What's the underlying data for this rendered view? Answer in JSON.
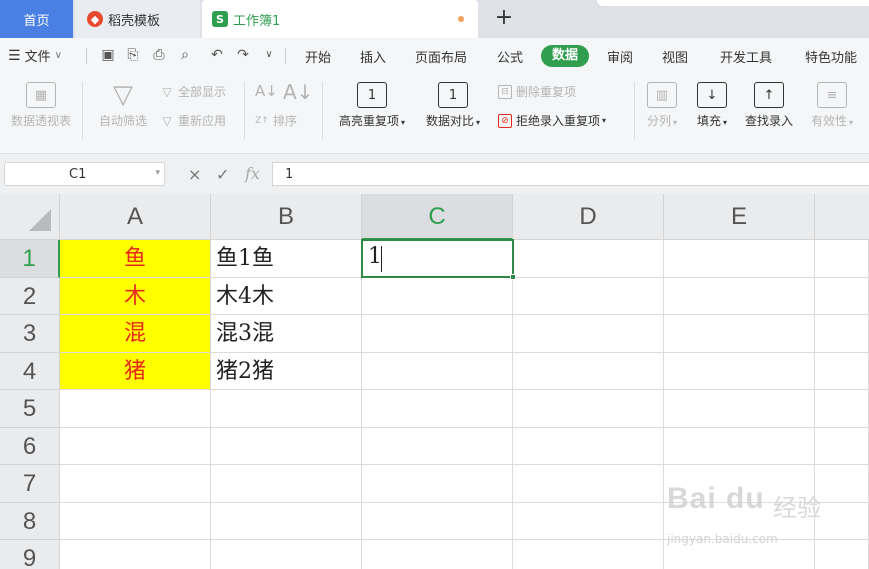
{
  "tabs": {
    "home": "首页",
    "docer": "稻壳模板",
    "workbook": "工作簿1",
    "add": "+"
  },
  "menu": {
    "file": "文件",
    "items": [
      "开始",
      "插入",
      "页面布局",
      "公式",
      "数据",
      "审阅",
      "视图",
      "开发工具",
      "特色功能"
    ],
    "active": "数据"
  },
  "ribbon": {
    "pivot": "数据透视表",
    "autofilter": "自动筛选",
    "show_all": "全部显示",
    "reapply": "重新应用",
    "sort": "排序",
    "highlight_dup": "高亮重复项",
    "compare": "数据对比",
    "remove_dup": "删除重复项",
    "reject_dup": "拒绝录入重复项",
    "split": "分列",
    "fill": "填充",
    "lookup": "查找录入",
    "validity": "有效性"
  },
  "formula_bar": {
    "name_box": "C1",
    "cancel": "×",
    "confirm": "✓",
    "fx": "fx",
    "value": "1"
  },
  "grid": {
    "columns": [
      "A",
      "B",
      "C",
      "D",
      "E"
    ],
    "selected_column": "C",
    "rows": [
      "1",
      "2",
      "3",
      "4",
      "5",
      "6",
      "7",
      "8",
      "9"
    ],
    "selected_row": "1",
    "col_a": [
      "鱼",
      "木",
      "混",
      "猪"
    ],
    "col_b": [
      "鱼1鱼",
      "木4木",
      "混3混",
      "猪2猪"
    ],
    "c1": "1",
    "highlight_color": "#ffff00",
    "text_color_a": "#e8281a",
    "accent": "#2f9f4f"
  },
  "watermark": {
    "logo": "Bai du",
    "text": "经验",
    "url": "jingyan.baidu.com"
  }
}
